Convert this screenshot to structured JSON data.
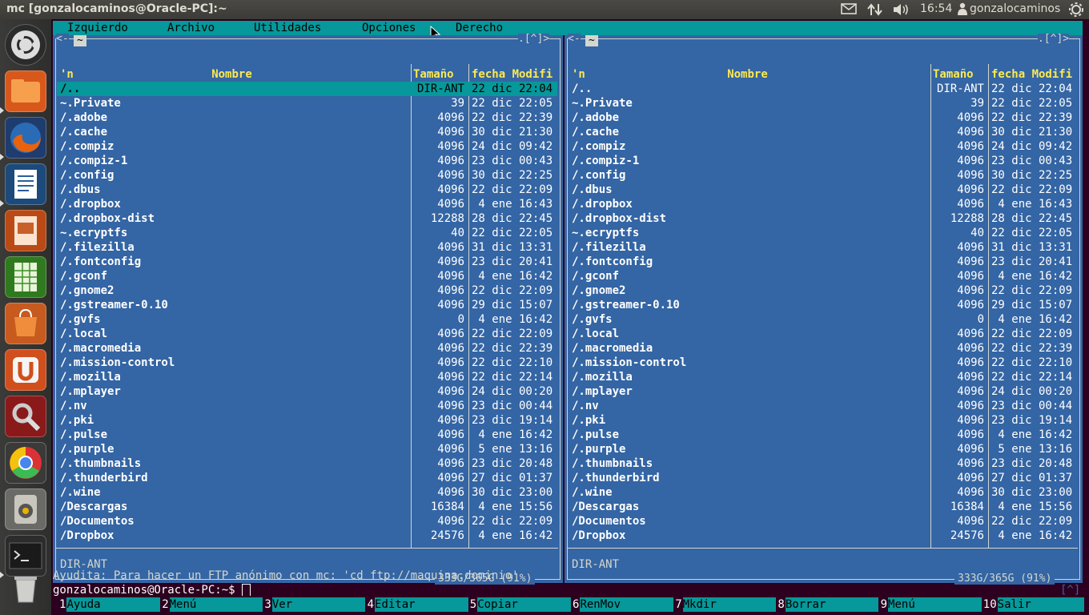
{
  "window_title": "mc [gonzalocaminos@Oracle-PC]:~",
  "system": {
    "time": "16:54",
    "user": "gonzalocaminos"
  },
  "launcher": [
    "ubuntu-dash",
    "files",
    "firefox",
    "writer",
    "impress",
    "calc",
    "software-center",
    "ubuntu-one",
    "system-settings",
    "chrome",
    "sound",
    "terminal",
    "trash"
  ],
  "menu": [
    "Izquierdo",
    "Archivo",
    "Utilidades",
    "Opciones",
    "Derecho"
  ],
  "panel_top_left": "~",
  "panel_top_marks": ".[^]>",
  "headers": {
    "n": "'n",
    "name": "Nombre",
    "size": "Tamaño",
    "date": "fecha Modifi"
  },
  "files": [
    {
      "name": "/..",
      "size": "DIR-ANT",
      "date": "22 dic 22:04"
    },
    {
      "name": "~.Private",
      "size": "39",
      "date": "22 dic 22:05"
    },
    {
      "name": "/.adobe",
      "size": "4096",
      "date": "22 dic 22:39"
    },
    {
      "name": "/.cache",
      "size": "4096",
      "date": "30 dic 21:30"
    },
    {
      "name": "/.compiz",
      "size": "4096",
      "date": "24 dic 09:42"
    },
    {
      "name": "/.compiz-1",
      "size": "4096",
      "date": "23 dic 00:43"
    },
    {
      "name": "/.config",
      "size": "4096",
      "date": "30 dic 22:25"
    },
    {
      "name": "/.dbus",
      "size": "4096",
      "date": "22 dic 22:09"
    },
    {
      "name": "/.dropbox",
      "size": "4096",
      "date": " 4 ene 16:43"
    },
    {
      "name": "/.dropbox-dist",
      "size": "12288",
      "date": "28 dic 22:45"
    },
    {
      "name": "~.ecryptfs",
      "size": "40",
      "date": "22 dic 22:05"
    },
    {
      "name": "/.filezilla",
      "size": "4096",
      "date": "31 dic 13:31"
    },
    {
      "name": "/.fontconfig",
      "size": "4096",
      "date": "23 dic 20:41"
    },
    {
      "name": "/.gconf",
      "size": "4096",
      "date": " 4 ene 16:42"
    },
    {
      "name": "/.gnome2",
      "size": "4096",
      "date": "22 dic 22:09"
    },
    {
      "name": "/.gstreamer-0.10",
      "size": "4096",
      "date": "29 dic 15:07"
    },
    {
      "name": "/.gvfs",
      "size": "0",
      "date": " 4 ene 16:42"
    },
    {
      "name": "/.local",
      "size": "4096",
      "date": "22 dic 22:09"
    },
    {
      "name": "/.macromedia",
      "size": "4096",
      "date": "22 dic 22:39"
    },
    {
      "name": "/.mission-control",
      "size": "4096",
      "date": "22 dic 22:10"
    },
    {
      "name": "/.mozilla",
      "size": "4096",
      "date": "22 dic 22:14"
    },
    {
      "name": "/.mplayer",
      "size": "4096",
      "date": "24 dic 00:20"
    },
    {
      "name": "/.nv",
      "size": "4096",
      "date": "23 dic 00:44"
    },
    {
      "name": "/.pki",
      "size": "4096",
      "date": "23 dic 19:14"
    },
    {
      "name": "/.pulse",
      "size": "4096",
      "date": " 4 ene 16:42"
    },
    {
      "name": "/.purple",
      "size": "4096",
      "date": " 5 ene 13:16"
    },
    {
      "name": "/.thumbnails",
      "size": "4096",
      "date": "23 dic 20:48"
    },
    {
      "name": "/.thunderbird",
      "size": "4096",
      "date": "27 dic 01:37"
    },
    {
      "name": "/.wine",
      "size": "4096",
      "date": "30 dic 23:00"
    },
    {
      "name": "/Descargas",
      "size": "16384",
      "date": " 4 ene 15:56"
    },
    {
      "name": "/Documentos",
      "size": "4096",
      "date": "22 dic 22:09"
    },
    {
      "name": "/Dropbox",
      "size": "24576",
      "date": " 4 ene 16:42"
    }
  ],
  "mini_status": "DIR-ANT",
  "disk_free": "333G/365G (91%)",
  "hint": "Ayudita: Para hacer un FTP anónimo con mc: 'cd ftp://maquina.dominio'",
  "prompt": "gonzalocaminos@Oracle-PC:~$ ",
  "prompt_right": "[^]",
  "fkeys": [
    {
      "num": "1",
      "label": "Ayuda"
    },
    {
      "num": "2",
      "label": "Menú"
    },
    {
      "num": "3",
      "label": "Ver"
    },
    {
      "num": "4",
      "label": "Editar"
    },
    {
      "num": "5",
      "label": "Copiar"
    },
    {
      "num": "6",
      "label": "RenMov"
    },
    {
      "num": "7",
      "label": "Mkdir"
    },
    {
      "num": "8",
      "label": "Borrar"
    },
    {
      "num": "9",
      "label": "Menú"
    },
    {
      "num": "10",
      "label": "Salir"
    }
  ],
  "colors": {
    "panel": "#3465a4",
    "accent": "#06989a",
    "header": "#fce94f",
    "terminal_bg": "#2c001e"
  }
}
